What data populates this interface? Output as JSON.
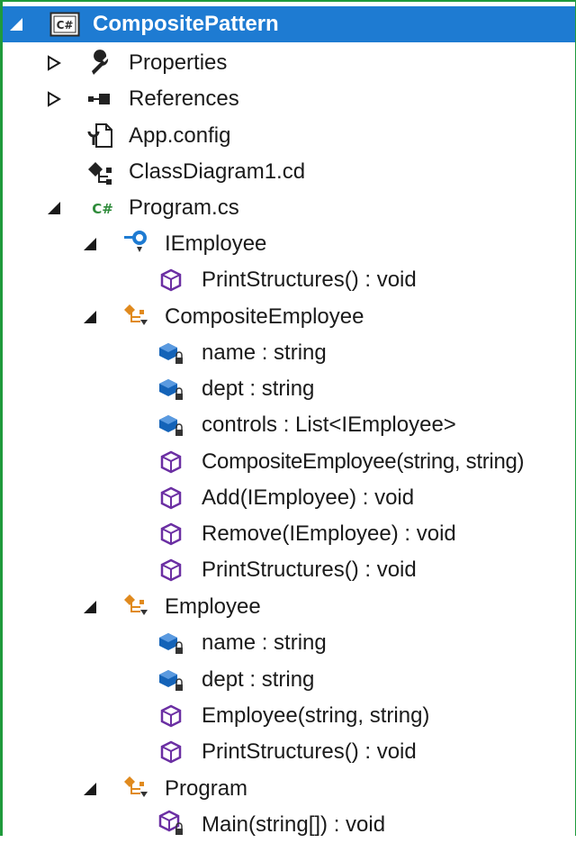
{
  "tree": {
    "project": {
      "label": "CompositePattern",
      "badge": "C#"
    },
    "properties": {
      "label": "Properties"
    },
    "references": {
      "label": "References"
    },
    "app_config": {
      "label": "App.config"
    },
    "class_diagram": {
      "label": "ClassDiagram1.cd"
    },
    "program_cs": {
      "label": "Program.cs",
      "badge": "C#"
    },
    "iemployee": {
      "label": "IEmployee",
      "members": [
        {
          "label": "PrintStructures() : void"
        }
      ]
    },
    "composite_employee": {
      "label": "CompositeEmployee",
      "members": [
        {
          "label": "name : string"
        },
        {
          "label": "dept : string"
        },
        {
          "label": "controls : List<IEmployee>"
        },
        {
          "label": "CompositeEmployee(string, string)"
        },
        {
          "label": "Add(IEmployee) : void"
        },
        {
          "label": "Remove(IEmployee) : void"
        },
        {
          "label": "PrintStructures() : void"
        }
      ]
    },
    "employee": {
      "label": "Employee",
      "members": [
        {
          "label": "name : string"
        },
        {
          "label": "dept : string"
        },
        {
          "label": "Employee(string, string)"
        },
        {
          "label": "PrintStructures() : void"
        }
      ]
    },
    "program": {
      "label": "Program",
      "members": [
        {
          "label": "Main(string[]) : void"
        }
      ]
    }
  },
  "colors": {
    "selection": "#1e7bd2",
    "frame_border": "#1f9a3c",
    "method_icon": "#6b2fa3",
    "field_icon": "#1463b8",
    "class_icon": "#e08a1e",
    "interface_icon": "#1e7bd2",
    "csharp_badge": "#2e8b3a"
  }
}
